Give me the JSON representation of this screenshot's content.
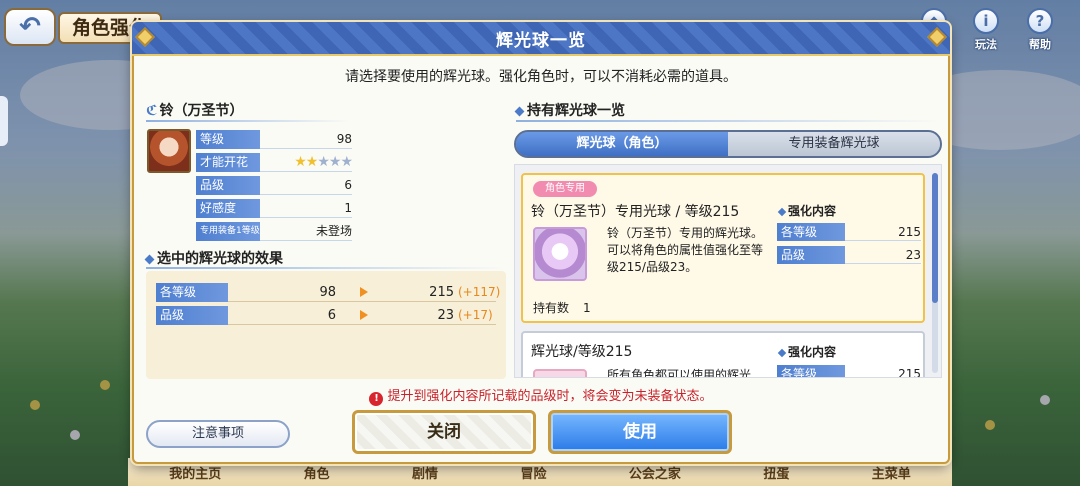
{
  "background": {
    "back_icon": "back-arrow-icon",
    "screen_title": "角色强化",
    "top_icons": [
      {
        "label": "",
        "icon": "bag-icon"
      },
      {
        "label": "玩法",
        "icon": "info-icon"
      },
      {
        "label": "帮助",
        "icon": "help-icon"
      }
    ],
    "bottom_nav": [
      "我的主页",
      "角色",
      "剧情",
      "冒险",
      "公会之家",
      "扭蛋",
      "主菜单"
    ]
  },
  "modal": {
    "title": "辉光球一览",
    "instruction": "请选择要使用的辉光球。强化角色时，可以不消耗必需的道具。"
  },
  "character": {
    "name": "铃（万圣节）",
    "stats": [
      {
        "label": "等级",
        "value": "98"
      },
      {
        "label": "才能开花",
        "stars_filled": 2,
        "stars_total": 5
      },
      {
        "label": "品级",
        "value": "6"
      },
      {
        "label": "好感度",
        "value": "1"
      },
      {
        "label": "专用装备1等级",
        "value": "未登场"
      }
    ]
  },
  "effect": {
    "heading": "选中的辉光球的效果",
    "rows": [
      {
        "label": "各等级",
        "before": "98",
        "after": "215",
        "plus": "(+117)"
      },
      {
        "label": "品级",
        "before": "6",
        "after": "23",
        "plus": "(+17)"
      }
    ]
  },
  "orb_list": {
    "heading": "持有辉光球一览",
    "tabs": [
      "辉光球（角色）",
      "专用装备辉光球"
    ],
    "cards": [
      {
        "badge": "角色专用",
        "title": "铃（万圣节）专用光球 / 等级215",
        "description": "铃（万圣节）专用的辉光球。可以将角色的属性值强化至等级215/品级23。",
        "owned_label": "持有数",
        "owned_count": "1",
        "enhance_heading": "强化内容",
        "enhance": [
          {
            "label": "各等级",
            "value": "215"
          },
          {
            "label": "品级",
            "value": "23"
          }
        ]
      },
      {
        "title": "辉光球/等级215",
        "description": "所有角色都可以使用的辉光",
        "enhance_heading": "强化内容",
        "enhance": [
          {
            "label": "各等级",
            "value": "215"
          }
        ]
      }
    ]
  },
  "warning": "提升到强化内容所记载的品级时，将会变为未装备状态。",
  "buttons": {
    "notes": "注意事项",
    "close": "关闭",
    "use": "使用"
  }
}
